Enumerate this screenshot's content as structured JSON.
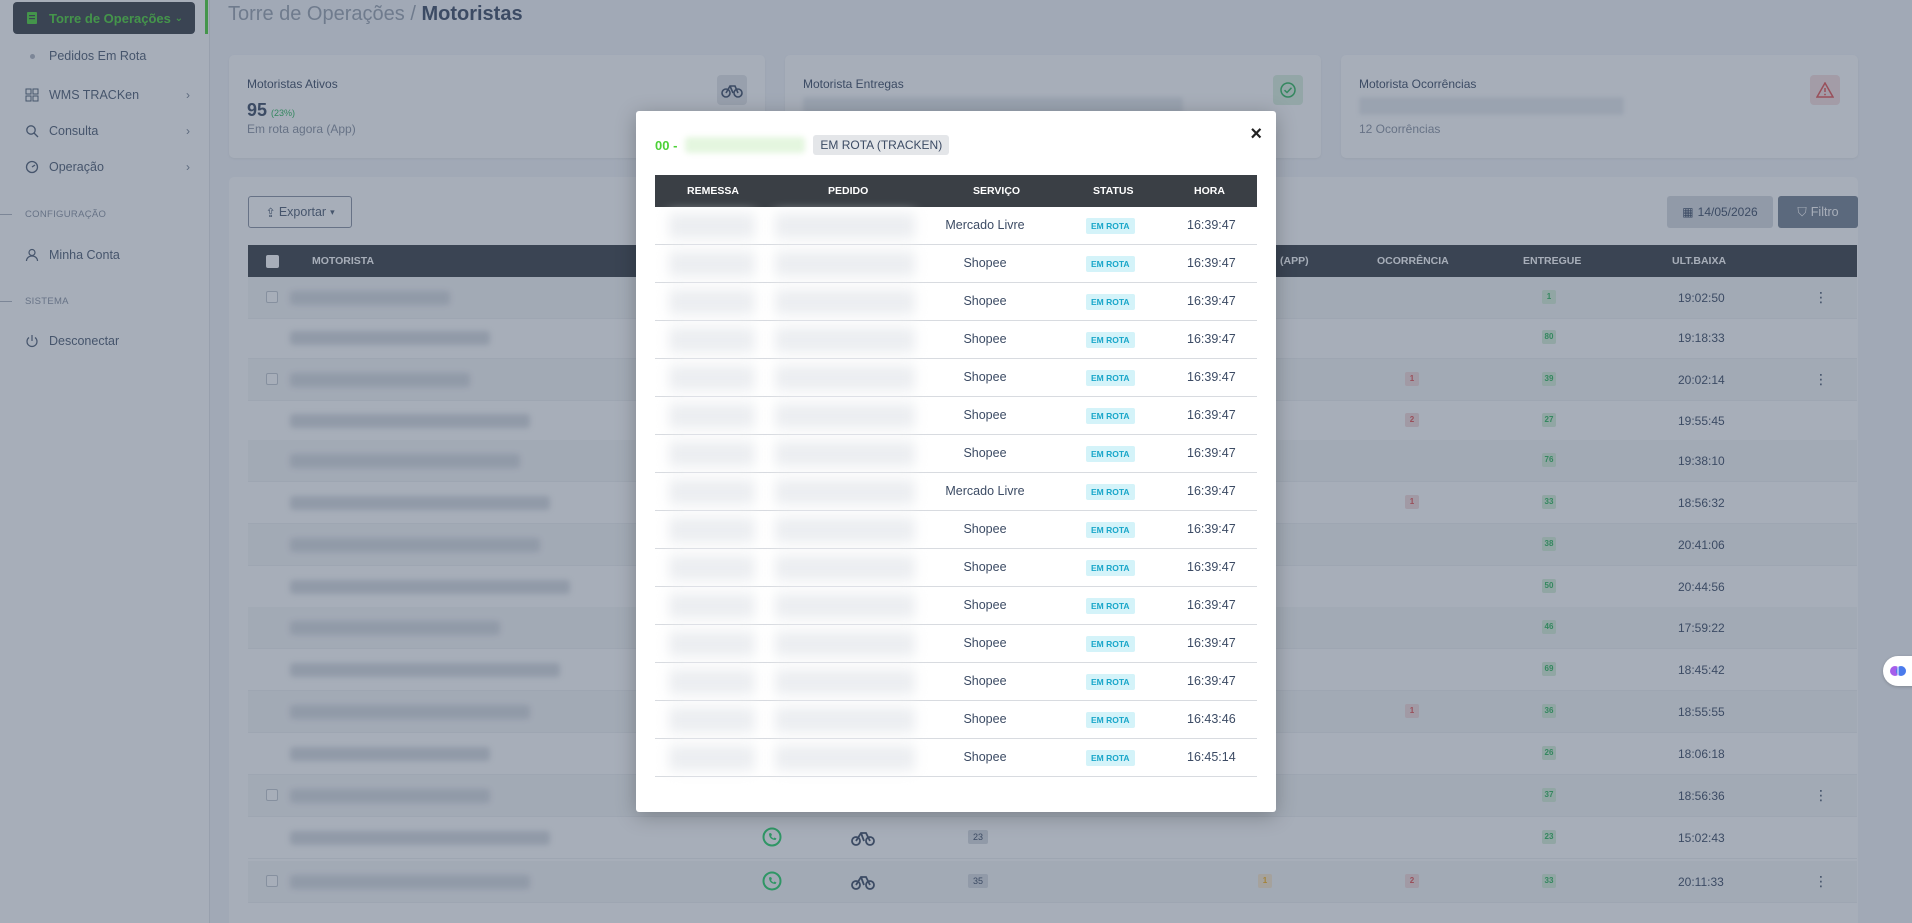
{
  "sidebar": {
    "top_item": "Torre de Operações",
    "sub_item": "Pedidos Em Rota",
    "items": [
      {
        "label": "WMS TRACKen",
        "icon": "grid-icon"
      },
      {
        "label": "Consulta",
        "icon": "search-icon"
      },
      {
        "label": "Operação",
        "icon": "gauge-icon"
      }
    ],
    "section_config": "CONFIGURAÇÃO",
    "account": "Minha Conta",
    "section_system": "SISTEMA",
    "logout": "Desconectar"
  },
  "breadcrumb": {
    "parent": "Torre de Operações / ",
    "current": "Motoristas"
  },
  "cards": {
    "ativos": {
      "title": "Motoristas Ativos",
      "value": "95",
      "pct": "(23%)",
      "sub": "Em rota agora (App)"
    },
    "entregas": {
      "title": "Motorista Entregas"
    },
    "ocorrencias": {
      "title": "Motorista Ocorrências",
      "sub": "12 Ocorrências"
    }
  },
  "toolbar": {
    "export": "Exportar",
    "date": "14/05/2026",
    "filter": "Filtro"
  },
  "table": {
    "headers": {
      "motorista": "MOTORISTA",
      "app": "(APP)",
      "ocorrencia": "OCORRÊNCIA",
      "entregue": "ENTREGUE",
      "ult_baixa": "ULT.BAIXA"
    },
    "rows": [
      {
        "entregue": "1",
        "ult_baixa": "19:02:50",
        "ocorrencia": "",
        "app": "",
        "num": ""
      },
      {
        "entregue": "80",
        "ult_baixa": "19:18:33",
        "ocorrencia": "",
        "app": "",
        "num": ""
      },
      {
        "entregue": "39",
        "ult_baixa": "20:02:14",
        "ocorrencia": "1",
        "app": "",
        "num": ""
      },
      {
        "entregue": "27",
        "ult_baixa": "19:55:45",
        "ocorrencia": "2",
        "app": "",
        "num": ""
      },
      {
        "entregue": "76",
        "ult_baixa": "19:38:10",
        "ocorrencia": "",
        "app": "",
        "num": ""
      },
      {
        "entregue": "33",
        "ult_baixa": "18:56:32",
        "ocorrencia": "1",
        "app": "",
        "num": ""
      },
      {
        "entregue": "38",
        "ult_baixa": "20:41:06",
        "ocorrencia": "",
        "app": "",
        "num": ""
      },
      {
        "entregue": "50",
        "ult_baixa": "20:44:56",
        "ocorrencia": "",
        "app": "",
        "num": ""
      },
      {
        "entregue": "46",
        "ult_baixa": "17:59:22",
        "ocorrencia": "",
        "app": "",
        "num": ""
      },
      {
        "entregue": "69",
        "ult_baixa": "18:45:42",
        "ocorrencia": "",
        "app": "",
        "num": ""
      },
      {
        "entregue": "36",
        "ult_baixa": "18:55:55",
        "ocorrencia": "1",
        "app": "",
        "num": ""
      },
      {
        "entregue": "26",
        "ult_baixa": "18:06:18",
        "ocorrencia": "",
        "app": "",
        "num": ""
      },
      {
        "entregue": "37",
        "ult_baixa": "18:56:36",
        "ocorrencia": "",
        "app": "",
        "num": ""
      },
      {
        "entregue": "23",
        "ult_baixa": "15:02:43",
        "ocorrencia": "",
        "app": "",
        "num": "23"
      },
      {
        "entregue": "33",
        "ult_baixa": "20:11:33",
        "ocorrencia": "2",
        "app": "1",
        "num": "35"
      }
    ]
  },
  "modal": {
    "code": "00 -",
    "status_tag": "EM ROTA (TRACKEN)",
    "close": "×",
    "headers": {
      "remessa": "REMESSA",
      "pedido": "PEDIDO",
      "servico": "SERVIÇO",
      "status": "STATUS",
      "hora": "HORA"
    },
    "rows": [
      {
        "servico": "Mercado Livre",
        "status": "EM ROTA",
        "hora": "16:39:47"
      },
      {
        "servico": "Shopee",
        "status": "EM ROTA",
        "hora": "16:39:47"
      },
      {
        "servico": "Shopee",
        "status": "EM ROTA",
        "hora": "16:39:47"
      },
      {
        "servico": "Shopee",
        "status": "EM ROTA",
        "hora": "16:39:47"
      },
      {
        "servico": "Shopee",
        "status": "EM ROTA",
        "hora": "16:39:47"
      },
      {
        "servico": "Shopee",
        "status": "EM ROTA",
        "hora": "16:39:47"
      },
      {
        "servico": "Shopee",
        "status": "EM ROTA",
        "hora": "16:39:47"
      },
      {
        "servico": "Mercado Livre",
        "status": "EM ROTA",
        "hora": "16:39:47"
      },
      {
        "servico": "Shopee",
        "status": "EM ROTA",
        "hora": "16:39:47"
      },
      {
        "servico": "Shopee",
        "status": "EM ROTA",
        "hora": "16:39:47"
      },
      {
        "servico": "Shopee",
        "status": "EM ROTA",
        "hora": "16:39:47"
      },
      {
        "servico": "Shopee",
        "status": "EM ROTA",
        "hora": "16:39:47"
      },
      {
        "servico": "Shopee",
        "status": "EM ROTA",
        "hora": "16:39:47"
      },
      {
        "servico": "Shopee",
        "status": "EM ROTA",
        "hora": "16:43:46"
      },
      {
        "servico": "Shopee",
        "status": "EM ROTA",
        "hora": "16:45:14"
      }
    ]
  },
  "colors": {
    "accent": "#4cd137",
    "dark": "#3a3f45",
    "status_bg": "#d4f3f9",
    "status_fg": "#19a6c9"
  }
}
